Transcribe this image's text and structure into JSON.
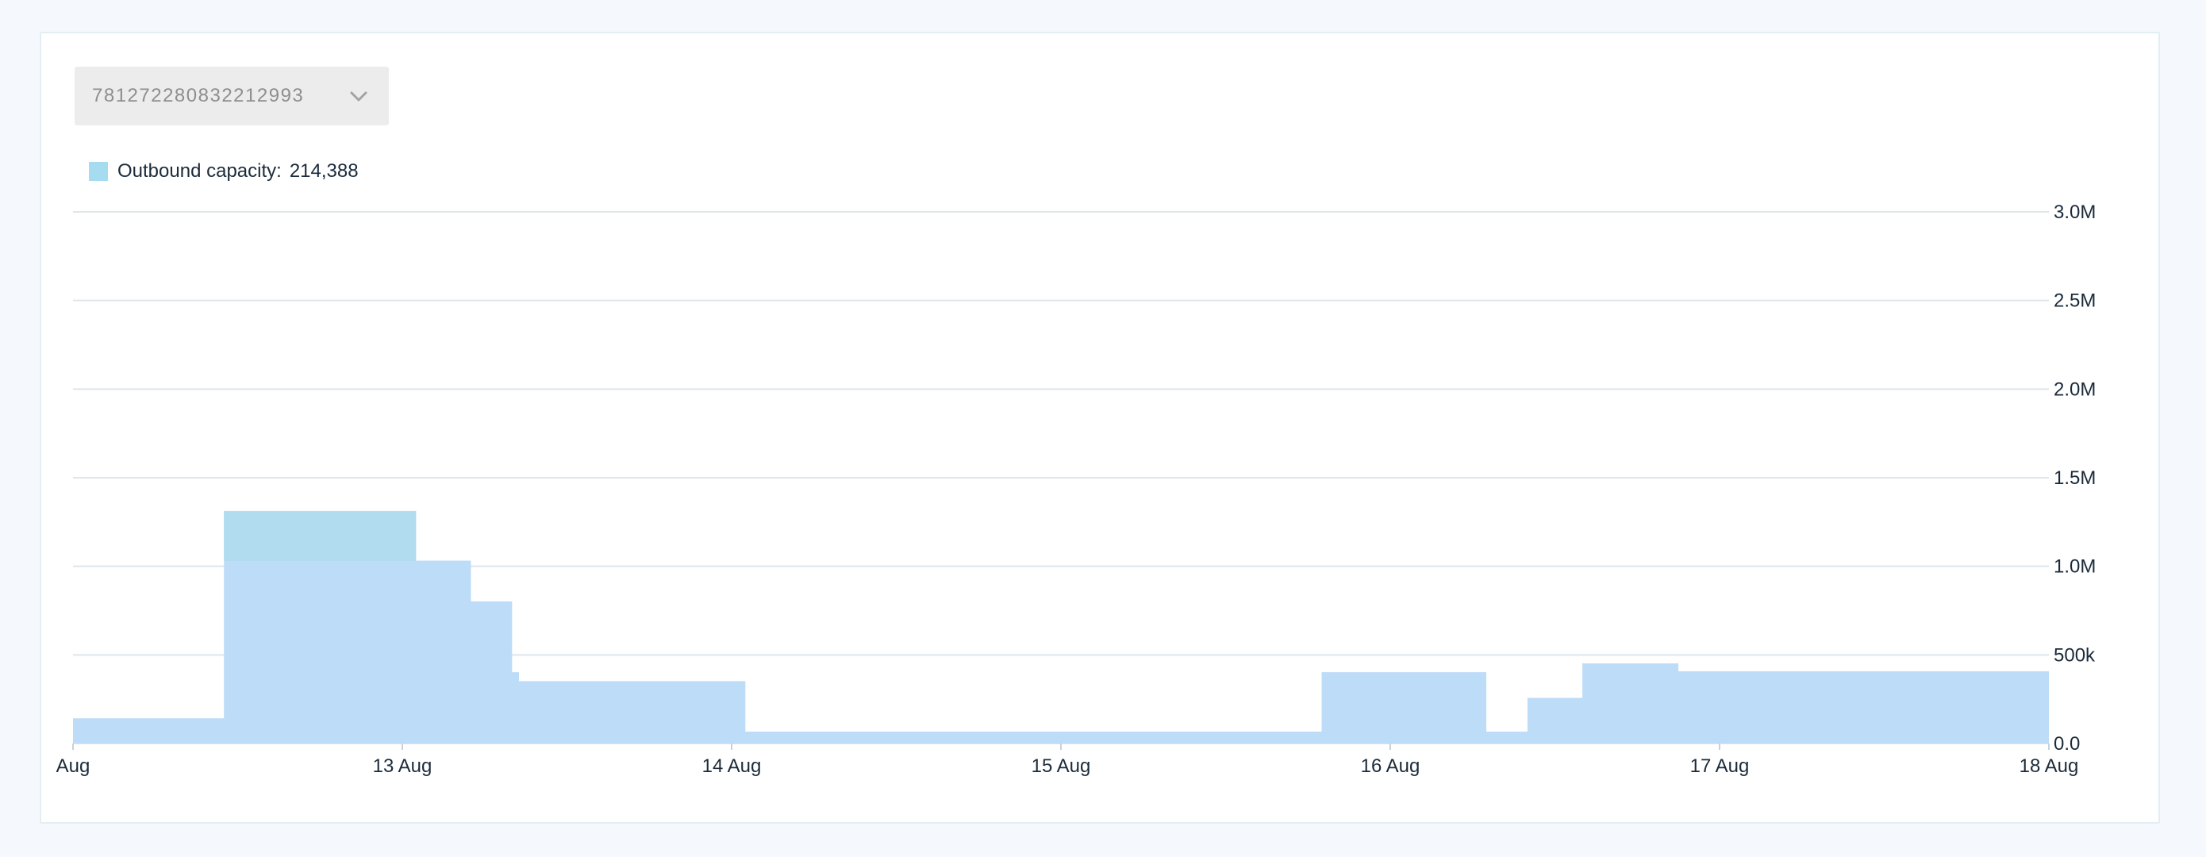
{
  "selector": {
    "value": "781272280832212993",
    "icon": "chevron-down-icon"
  },
  "legend": {
    "label": "Outbound capacity:",
    "value": "214,388",
    "color": "#a6dcf0"
  },
  "chart_data": {
    "type": "area",
    "series": [
      {
        "name": "Outbound capacity",
        "color": "#bcdcf7",
        "highlight_color": "#b1dcf0",
        "points": [
          {
            "x": "2023-08-12T00:00",
            "y": 140000
          },
          {
            "x": "2023-08-12T11:00",
            "y": 1310000
          },
          {
            "x": "2023-08-13T01:00",
            "y": 1030000
          },
          {
            "x": "2023-08-13T05:00",
            "y": 800000
          },
          {
            "x": "2023-08-13T08:00",
            "y": 400000
          },
          {
            "x": "2023-08-13T08:30",
            "y": 350000
          },
          {
            "x": "2023-08-14T01:00",
            "y": 65000
          },
          {
            "x": "2023-08-15T19:00",
            "y": 400000
          },
          {
            "x": "2023-08-16T07:00",
            "y": 65000
          },
          {
            "x": "2023-08-16T10:00",
            "y": 255000
          },
          {
            "x": "2023-08-16T14:00",
            "y": 450000
          },
          {
            "x": "2023-08-16T21:00",
            "y": 405000
          },
          {
            "x": "2023-08-18T00:00",
            "y": 405000
          }
        ]
      }
    ],
    "x_ticks": [
      "Aug",
      "13 Aug",
      "14 Aug",
      "15 Aug",
      "16 Aug",
      "17 Aug",
      "18 Aug"
    ],
    "y_ticks": [
      "0.0",
      "500k",
      "1.0M",
      "1.5M",
      "2.0M",
      "2.5M",
      "3.0M"
    ],
    "xlim": [
      "2023-08-12T00:00",
      "2023-08-18T00:00"
    ],
    "ylim": [
      0,
      3000000
    ],
    "grid": true,
    "y_axis_side": "right",
    "step": "after"
  }
}
